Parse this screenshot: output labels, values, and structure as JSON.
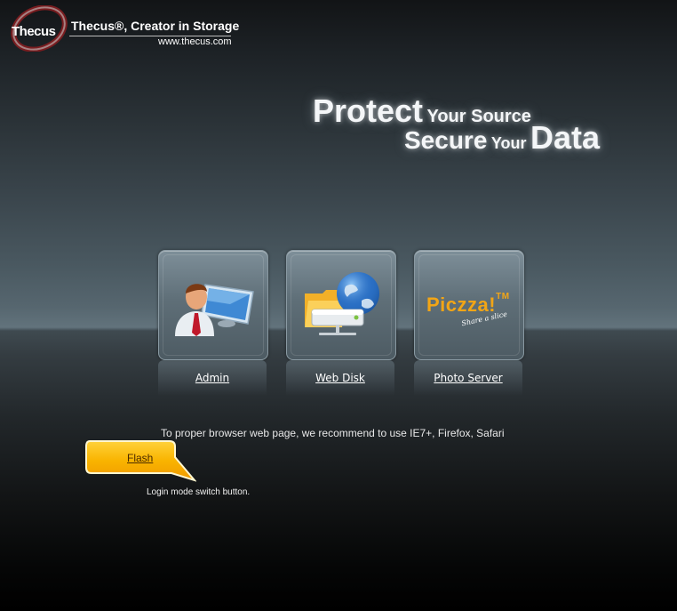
{
  "branding": {
    "logo_brand": "Thecus",
    "tagline": "Thecus®, Creator in Storage",
    "url": "www.thecus.com"
  },
  "headline": {
    "protect": "Protect",
    "your_source": "Your Source",
    "secure": "Secure",
    "your": "Your",
    "data": "Data"
  },
  "tiles": [
    {
      "label": "Admin",
      "icon": "admin-user-monitor-icon"
    },
    {
      "label": "Web Disk",
      "icon": "web-disk-globe-folder-icon"
    },
    {
      "label": "Photo Server",
      "icon": "piczza-logo"
    }
  ],
  "piczza": {
    "text": "Piczza!",
    "tm": "TM",
    "sub": "Share a slice"
  },
  "recommendation": "To proper browser web page, we recommend to use IE7+, Firefox, Safari",
  "login_mode": {
    "button_label": "Flash",
    "hint": "Login mode switch button."
  },
  "colors": {
    "accent_orange": "#f6a800",
    "piczza_orange": "#f2a516"
  }
}
